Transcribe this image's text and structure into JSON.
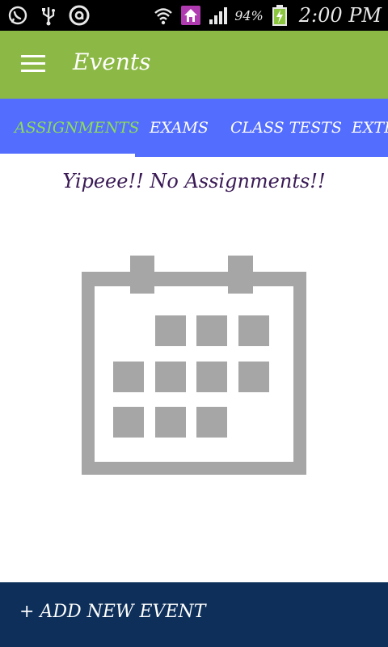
{
  "status_bar": {
    "battery_percent": "94%",
    "time": "2:00 PM",
    "icons": [
      "whatsapp-icon",
      "usb-icon",
      "circle-a-icon",
      "wifi-icon",
      "home-notification-icon",
      "signal-icon",
      "battery-charging-icon"
    ]
  },
  "app_bar": {
    "title": "Events"
  },
  "tabs": [
    {
      "label": "ASSIGNMENTS",
      "active": true
    },
    {
      "label": "EXAMS",
      "active": false
    },
    {
      "label": "CLASS TESTS",
      "active": false
    },
    {
      "label": "EXTR",
      "active": false
    }
  ],
  "empty_state": {
    "message": "Yipeee!! No Assignments!!",
    "icon": "calendar-icon"
  },
  "add_button": {
    "label": "+ ADD NEW EVENT"
  },
  "colors": {
    "status_bar": "#000000",
    "app_bar": "#8cb845",
    "tab_bar": "#536dfe",
    "active_tab_text": "#8cdc5a",
    "empty_text": "#3a1a55",
    "calendar_gray": "#a6a6a6",
    "add_button": "#0d2f5a"
  }
}
